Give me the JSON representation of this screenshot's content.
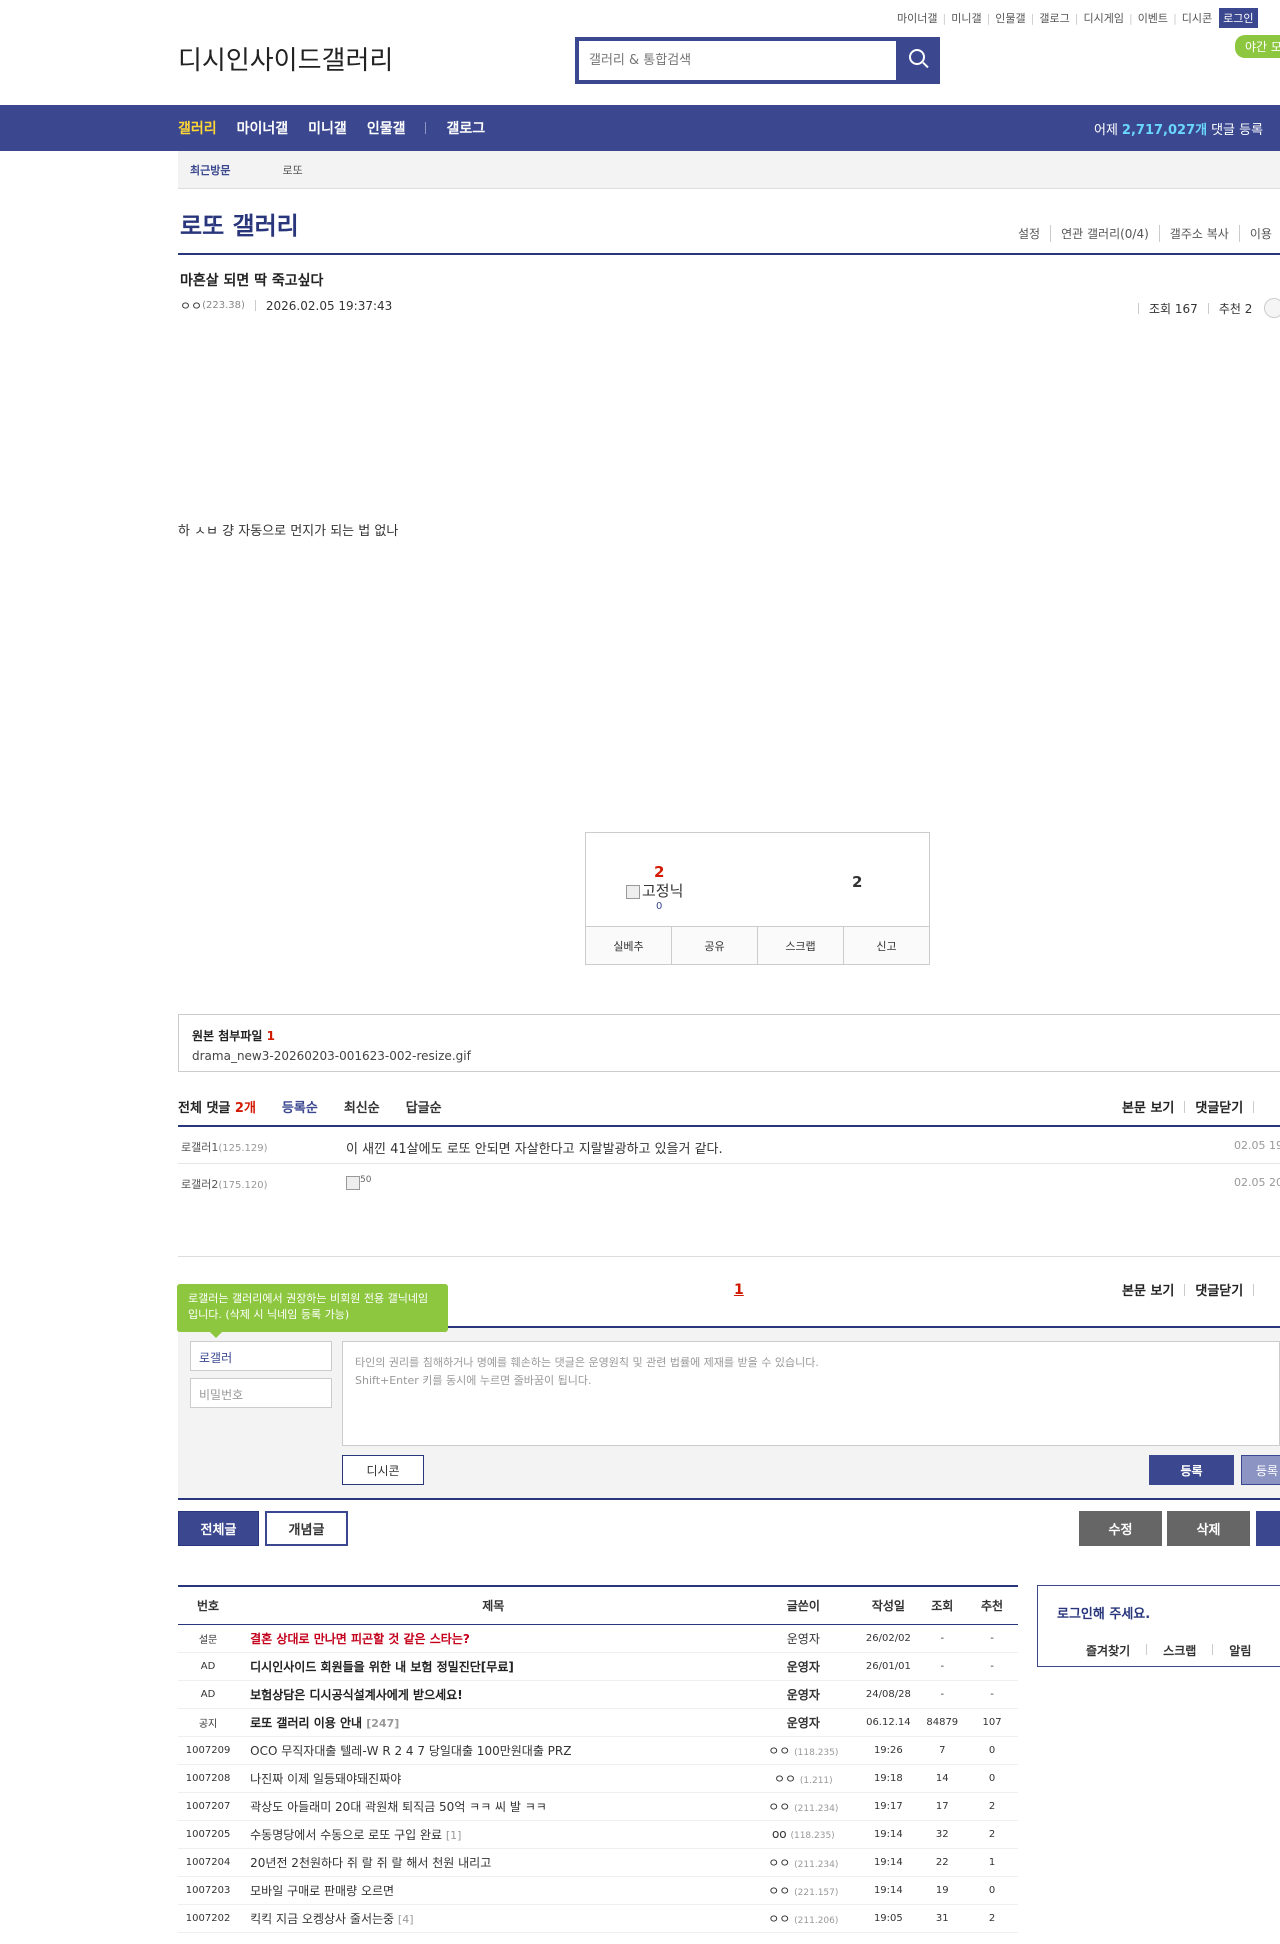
{
  "topnav": {
    "items": [
      "마이너갤",
      "미니갤",
      "인물갤",
      "갤로그",
      "디시게임",
      "이벤트",
      "디시콘"
    ],
    "login": "로그인",
    "night": "야간 모"
  },
  "header": {
    "logo_alt": "디시인사이드갤러리",
    "search_placeholder": "갤러리 & 통합검색"
  },
  "gnb": {
    "items": [
      "갤러리",
      "마이너갤",
      "미니갤",
      "인물갤",
      "갤로그"
    ],
    "stat_prefix": "어제",
    "stat_value": "2,717,027개",
    "stat_suffix": "댓글 등록"
  },
  "recent": {
    "label": "최근방문",
    "value": "로또"
  },
  "gallery": {
    "title": "로또 갤러리",
    "menu": [
      "설정",
      "연관 갤러리(0/4)",
      "갤주소 복사",
      "이용"
    ]
  },
  "post": {
    "title": "마흔살 되면 딱 죽고싶다",
    "writer": "ㅇㅇ",
    "ip": "(223.38)",
    "datetime": "2026.02.05 19:37:43",
    "views": "조회 167",
    "recommend": "추천 2",
    "body": "하 ㅅㅂ 걍 자동으로 먼지가 되는 법 없나"
  },
  "reco": {
    "up": "2",
    "fixnick": "고정닉",
    "fixnick_count": "0",
    "down": "2",
    "buttons": [
      "실베추",
      "공유",
      "스크랩",
      "신고"
    ]
  },
  "attach": {
    "label": "원본 첨부파일",
    "count": "1",
    "file": "drama_new3-20260203-001623-002-resize.gif"
  },
  "comments": {
    "total_label": "전체 댓글",
    "total_count": "2개",
    "sorts": [
      "등록순",
      "최신순",
      "답글순"
    ],
    "right": [
      "본문 보기",
      "댓글닫기"
    ],
    "rows": [
      {
        "nick": "로갤러1",
        "ip": "(125.129)",
        "text": "이 새낀 41살에도 로또 안되면 자살한다고 지랄발광하고 있을거 같다.",
        "date": "02.05 19"
      },
      {
        "nick": "로갤러2",
        "ip": "(175.120)",
        "text": "50",
        "date": "02.05 20"
      }
    ],
    "page": "1"
  },
  "write": {
    "tooltip": "로갤러는 갤러리에서 권장하는 비회원 전용 갤닉네임입니다. (삭제 시 닉네임 등록 가능)",
    "nick": "로갤러",
    "pw_placeholder": "비밀번호",
    "textarea": "타인의 권리를 침해하거나 명예를 훼손하는 댓글은 운영원칙 및 관련 법률에 제재를 받을 수 있습니다.\nShift+Enter 키를 동시에 누르면 줄바꿈이 됩니다.",
    "dccon": "디시콘",
    "submit": "등록",
    "submit2": "등록"
  },
  "buttons": {
    "all": "전체글",
    "concept": "개념글",
    "edit": "수정",
    "delete": "삭제"
  },
  "list": {
    "headers": [
      "번호",
      "제목",
      "글쓴이",
      "작성일",
      "조회",
      "추천"
    ],
    "rows": [
      {
        "num": "설문",
        "subject": "결혼 상대로 만나면 피곤할 것 같은 스타는?",
        "reply": "",
        "writer": "운영자",
        "ip": "",
        "date": "26/02/02",
        "view": "-",
        "rec": "-",
        "style": "red"
      },
      {
        "num": "AD",
        "subject": "디시인사이드 회원들을 위한 내 보험 정밀진단[무료]",
        "reply": "",
        "writer": "운영자",
        "ip": "",
        "date": "26/01/01",
        "view": "-",
        "rec": "-",
        "style": "bold"
      },
      {
        "num": "AD",
        "subject": "보험상담은 디시공식설계사에게 받으세요!",
        "reply": "",
        "writer": "운영자",
        "ip": "",
        "date": "24/08/28",
        "view": "-",
        "rec": "-",
        "style": "bold"
      },
      {
        "num": "공지",
        "subject": "로또 갤러리 이용 안내",
        "reply": "[247]",
        "writer": "운영자",
        "ip": "",
        "date": "06.12.14",
        "view": "84879",
        "rec": "107",
        "style": "bold"
      },
      {
        "num": "1007209",
        "subject": "OCO 무직자대출 텔레-W R 2 4 7 당일대출 100만원대출 PRZ",
        "reply": "",
        "writer": "ㅇㅇ",
        "ip": "(118.235)",
        "date": "19:26",
        "view": "7",
        "rec": "0",
        "style": ""
      },
      {
        "num": "1007208",
        "subject": "나진짜 이제 일등돼야돼진짜야",
        "reply": "",
        "writer": "ㅇㅇ",
        "ip": "(1.211)",
        "date": "19:18",
        "view": "14",
        "rec": "0",
        "style": ""
      },
      {
        "num": "1007207",
        "subject": "곽상도 아들래미 20대 곽원채 퇴직금 50억 ㅋㅋ 씨 발 ㅋㅋ",
        "reply": "",
        "writer": "ㅇㅇ",
        "ip": "(211.234)",
        "date": "19:17",
        "view": "17",
        "rec": "2",
        "style": ""
      },
      {
        "num": "1007205",
        "subject": "수동명당에서 수동으로 로또 구입 완료",
        "reply": "[1]",
        "writer": "oo",
        "ip": "(118.235)",
        "date": "19:14",
        "view": "32",
        "rec": "2",
        "style": ""
      },
      {
        "num": "1007204",
        "subject": "20년전 2천원하다 쥐 랄 쥐 랄 해서 천원 내리고",
        "reply": "",
        "writer": "ㅇㅇ",
        "ip": "(211.234)",
        "date": "19:14",
        "view": "22",
        "rec": "1",
        "style": ""
      },
      {
        "num": "1007203",
        "subject": "모바일 구매로 판매량 오르면",
        "reply": "",
        "writer": "ㅇㅇ",
        "ip": "(221.157)",
        "date": "19:14",
        "view": "19",
        "rec": "0",
        "style": ""
      },
      {
        "num": "1007202",
        "subject": "킥킥 지금 오켕상사 줄서는중",
        "reply": "[4]",
        "writer": "ㅇㅇ",
        "ip": "(211.206)",
        "date": "19:05",
        "view": "31",
        "rec": "2",
        "style": ""
      }
    ]
  },
  "loginbox": {
    "title": "로그인해 주세요.",
    "links": [
      "즐겨찾기",
      "스크랩",
      "알림"
    ]
  }
}
